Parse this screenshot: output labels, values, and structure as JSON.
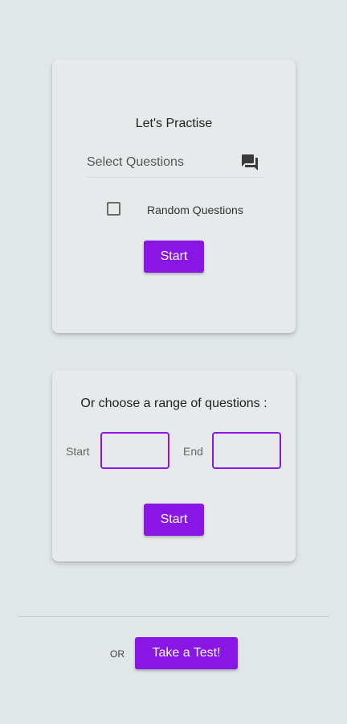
{
  "practise": {
    "title": "Let's Practise",
    "select_label": "Select Questions",
    "select_icon": "chat-bubbles-icon",
    "random_label": "Random Questions",
    "random_checked": false,
    "start_label": "Start"
  },
  "range": {
    "title": "Or choose a range of questions :",
    "start_label": "Start",
    "end_label": "End",
    "start_value": "",
    "end_value": "",
    "start_button": "Start"
  },
  "footer": {
    "or_label": "OR",
    "test_button": "Take a Test!"
  },
  "colors": {
    "accent": "#8a16e6",
    "background": "#e1e7e9",
    "card": "#e6eaeb"
  }
}
